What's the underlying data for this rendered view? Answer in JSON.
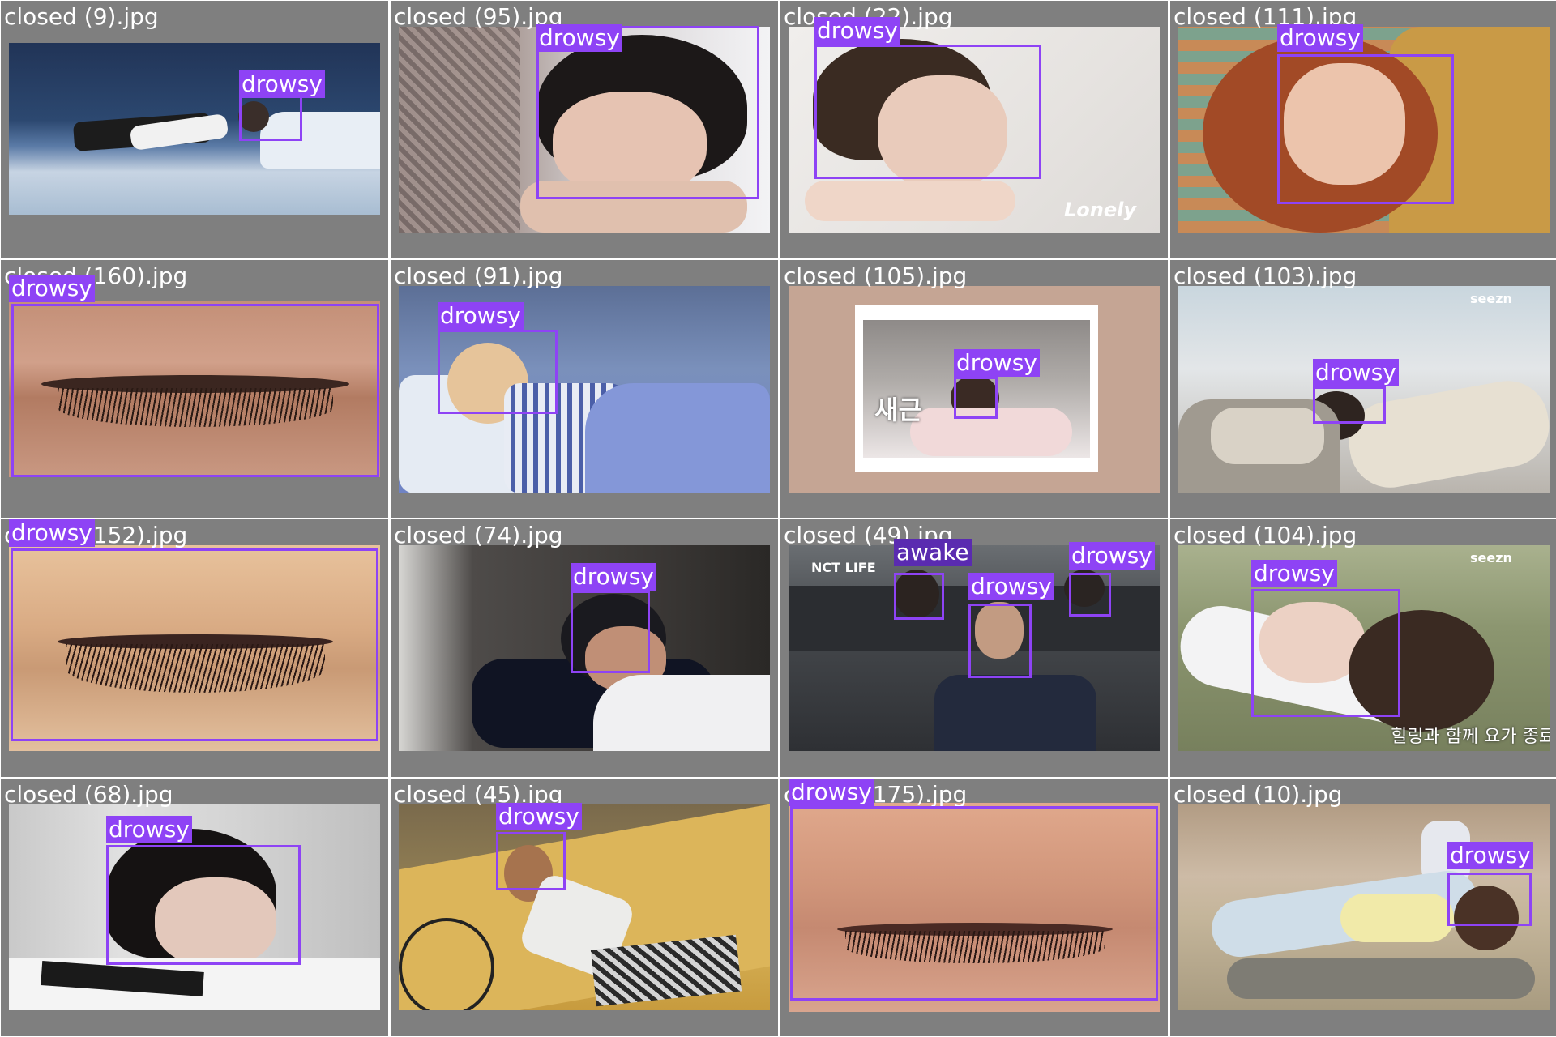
{
  "colors": {
    "box": "#8e43f5",
    "tile_bg": "#7f7f7f",
    "label_text": "#ffffff"
  },
  "tiles": [
    {
      "filename": "closed (9).jpg",
      "detections": [
        {
          "label": "drowsy"
        }
      ]
    },
    {
      "filename": "closed (95).jpg",
      "detections": [
        {
          "label": "drowsy"
        }
      ]
    },
    {
      "filename": "closed (22).jpg",
      "photo_text": "Lonely",
      "detections": [
        {
          "label": "drowsy"
        }
      ]
    },
    {
      "filename": "closed (111).jpg",
      "detections": [
        {
          "label": "drowsy"
        }
      ]
    },
    {
      "filename": "closed (160).jpg",
      "detections": [
        {
          "label": "drowsy"
        }
      ]
    },
    {
      "filename": "closed (91).jpg",
      "detections": [
        {
          "label": "drowsy"
        }
      ]
    },
    {
      "filename": "closed (105).jpg",
      "photo_text": "새근",
      "detections": [
        {
          "label": "drowsy"
        }
      ]
    },
    {
      "filename": "closed (103).jpg",
      "photo_text": "seezn",
      "detections": [
        {
          "label": "drowsy"
        }
      ]
    },
    {
      "filename": "closed (152).jpg",
      "detections": [
        {
          "label": "drowsy"
        }
      ]
    },
    {
      "filename": "closed (74).jpg",
      "detections": [
        {
          "label": "drowsy"
        }
      ]
    },
    {
      "filename": "closed (49).jpg",
      "photo_text": "NCT LIFE",
      "detections": [
        {
          "label": "awake"
        },
        {
          "label": "drowsy"
        },
        {
          "label": "drowsy"
        }
      ]
    },
    {
      "filename": "closed (104).jpg",
      "photo_text": "seezn",
      "photo_caption": "힐링과 함께 요가 종료",
      "detections": [
        {
          "label": "drowsy"
        }
      ]
    },
    {
      "filename": "closed (68).jpg",
      "detections": [
        {
          "label": "drowsy"
        }
      ]
    },
    {
      "filename": "closed (45).jpg",
      "detections": [
        {
          "label": "drowsy"
        }
      ]
    },
    {
      "filename": "closed (175).jpg",
      "detections": [
        {
          "label": "drowsy"
        }
      ]
    },
    {
      "filename": "closed (10).jpg",
      "detections": [
        {
          "label": "drowsy"
        }
      ]
    }
  ]
}
